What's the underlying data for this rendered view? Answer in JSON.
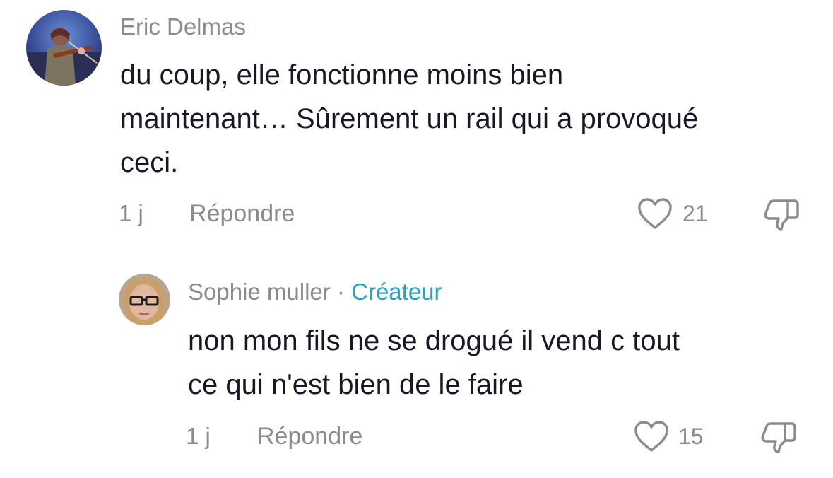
{
  "comments": [
    {
      "author": "Eric Delmas",
      "text_line1": "du coup, elle fonctionne moins bien",
      "text_line2": "maintenant… Sûrement un rail qui a provoqué",
      "text_line3": "ceci.",
      "time": "1 j",
      "reply_label": "Répondre",
      "likes": "21"
    },
    {
      "author": "Sophie muller",
      "separator": "·",
      "badge": "Créateur",
      "text_line1": "non mon fils ne se drogué il vend c tout",
      "text_line2": "ce qui n'est bien de le faire",
      "time": "1 j",
      "reply_label": "Répondre",
      "likes": "15"
    }
  ],
  "icons": {
    "like": "heart-outline-icon",
    "dislike": "thumbs-down-outline-icon"
  },
  "colors": {
    "text": "#161823",
    "muted": "#8a8b91",
    "creator_badge": "#25a3c8"
  }
}
